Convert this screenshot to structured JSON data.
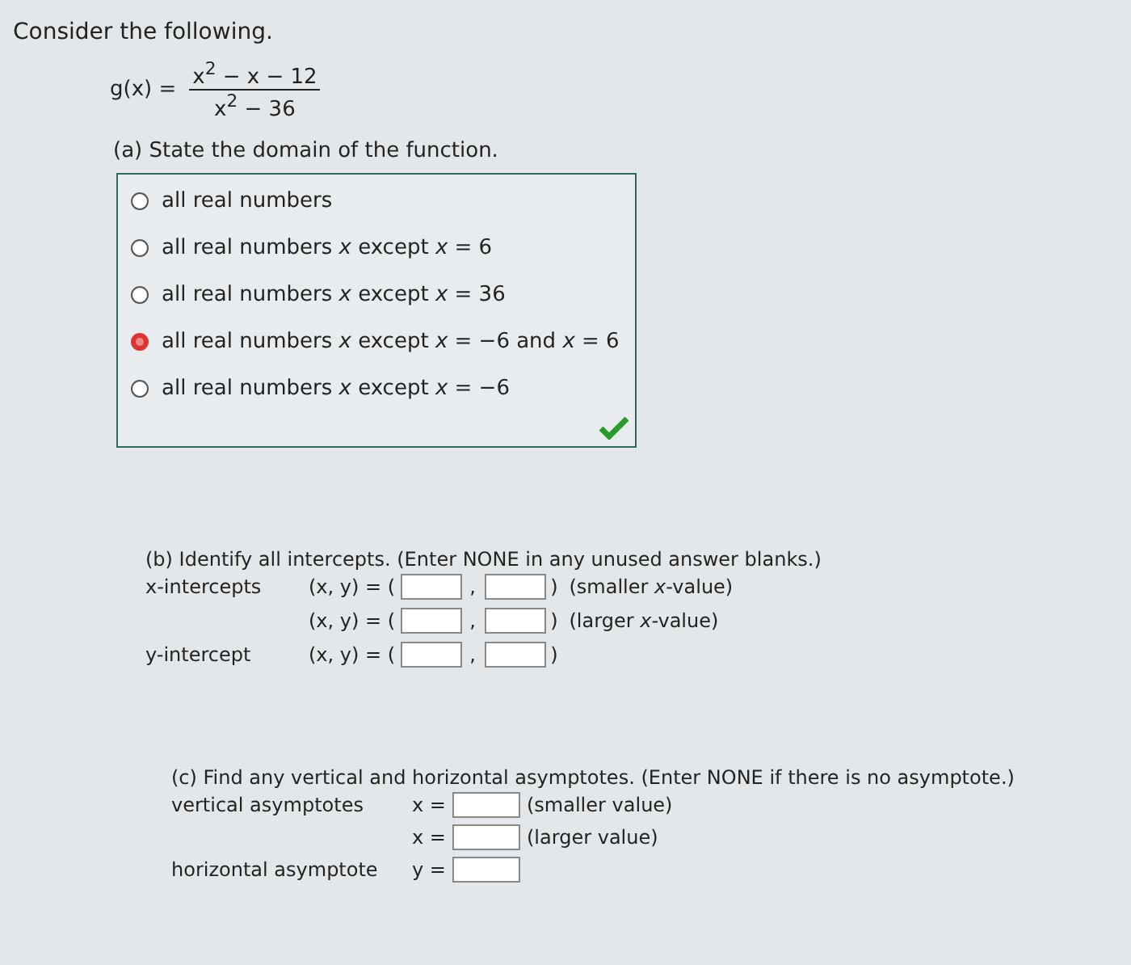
{
  "intro": "Consider the following.",
  "function": {
    "name": "g(x) =",
    "numerator": "x$^{2}$ − x − 12",
    "denominator": "x$^{2}$ − 36"
  },
  "part_a": {
    "prompt": "(a) State the domain of the function.",
    "correct": true,
    "options": [
      {
        "label": "all real numbers",
        "selected": false
      },
      {
        "label": "all real numbers *x* except *x* = 6",
        "selected": false
      },
      {
        "label": "all real numbers *x* except *x* = 36",
        "selected": false
      },
      {
        "label": "all real numbers *x* except *x* = −6 and *x* = 6",
        "selected": true
      },
      {
        "label": "all real numbers *x* except *x* = −6",
        "selected": false
      }
    ]
  },
  "part_b": {
    "prompt": "(b) Identify all intercepts. (Enter NONE in any unused answer blanks.)",
    "rows": [
      {
        "label": "x-intercepts",
        "expr": "(x, y) = (",
        "comma": ",",
        "close": ")",
        "note": "(smaller *x*-value)"
      },
      {
        "label": "",
        "expr": "(x, y) = (",
        "comma": ",",
        "close": ")",
        "note": "(larger *x*-value)"
      },
      {
        "label": "y-intercept",
        "expr": "(x, y) = (",
        "comma": ",",
        "close": ")",
        "note": ""
      }
    ]
  },
  "part_c": {
    "prompt": "(c) Find any vertical and horizontal asymptotes. (Enter NONE if there is no asymptote.)",
    "rows": [
      {
        "label": "vertical asymptotes",
        "expr": "x =",
        "note": "(smaller value)"
      },
      {
        "label": "",
        "expr": "x =",
        "note": "(larger value)"
      },
      {
        "label": "horizontal asymptote",
        "expr": "y =",
        "note": ""
      }
    ]
  }
}
